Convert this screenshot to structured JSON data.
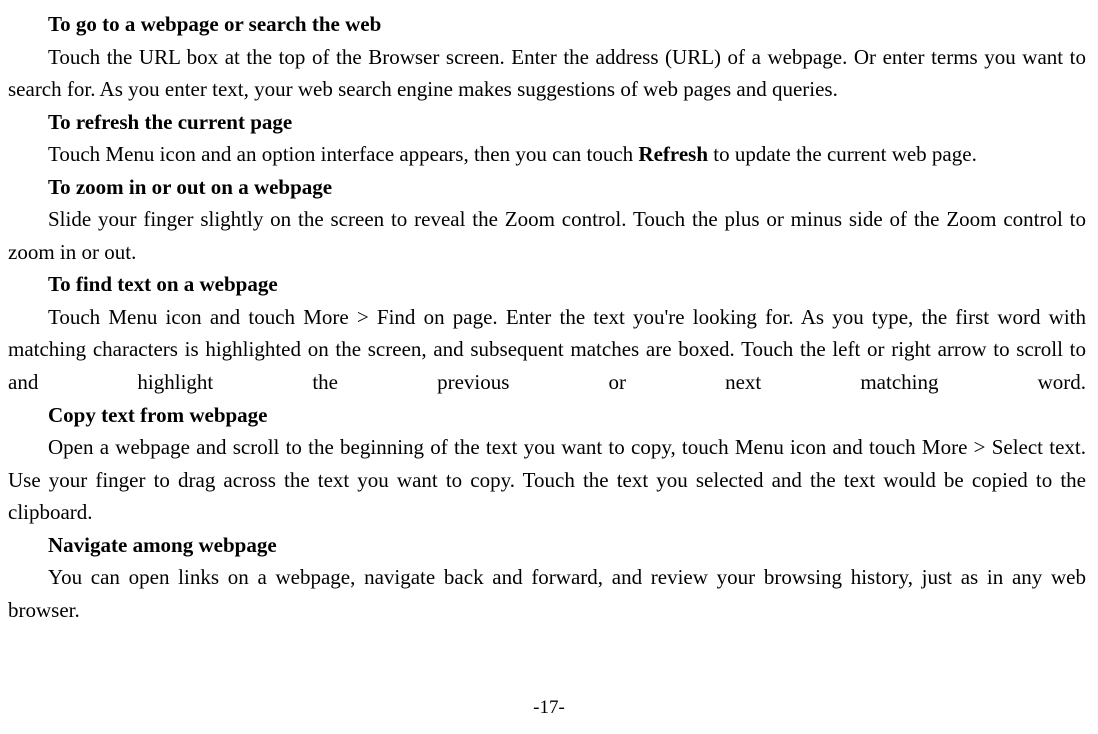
{
  "sections": {
    "s1": {
      "heading": "To go to a webpage or search the web",
      "body": "Touch the URL box at the top of the Browser screen. Enter the address (URL) of a webpage. Or enter terms you want to search for. As you enter text, your web search engine makes suggestions of web pages and queries."
    },
    "s2": {
      "heading": "To refresh the current page",
      "body_pre": "Touch Menu icon and an option interface appears, then you can touch ",
      "bold": "Refresh",
      "body_post": " to update the current web page."
    },
    "s3": {
      "heading": "To zoom in or out on a webpage",
      "body": "Slide your finger slightly on the screen to reveal the Zoom control. Touch the plus or minus side of the Zoom control to zoom in or out."
    },
    "s4": {
      "heading": "To find text on a webpage",
      "body": "Touch Menu icon and touch More > Find on page. Enter the text you're looking for. As you type, the first word with matching characters is highlighted on the screen, and subsequent matches are boxed. Touch the left or right arrow to scroll to and highlight the previous or next matching word."
    },
    "s5": {
      "heading": "Copy text from webpage",
      "body": "Open a webpage and scroll to the beginning of the text you want to copy, touch Menu icon and touch More > Select text. Use your finger to drag across the text you want to copy. Touch the text you selected and the text would be copied to the clipboard."
    },
    "s6": {
      "heading": "Navigate among webpage",
      "body": "You can open links on a webpage, navigate back and forward, and review your browsing history, just as in any web browser."
    }
  },
  "page_number": "-17-"
}
